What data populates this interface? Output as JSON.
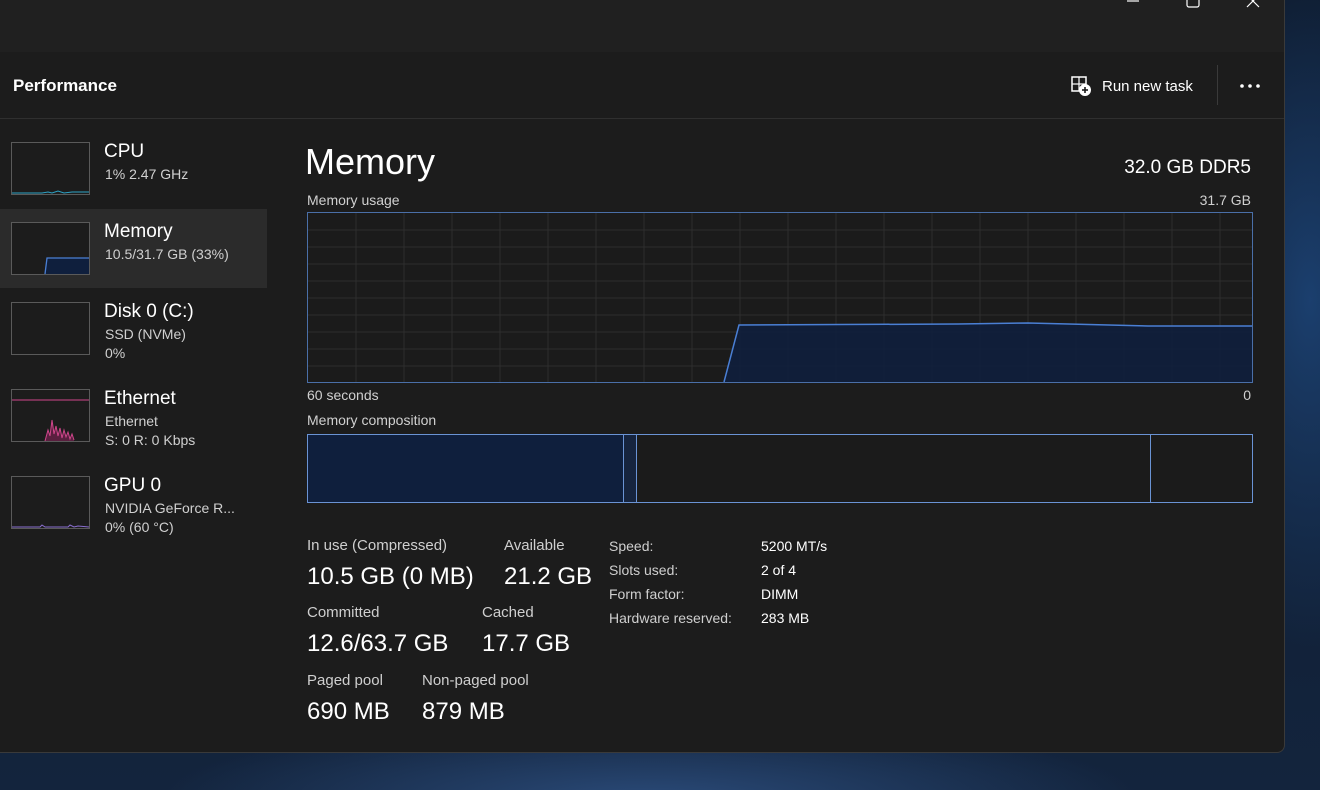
{
  "header": {
    "title": "Performance",
    "run_new_task": "Run new task"
  },
  "sidebar": {
    "items": [
      {
        "name": "CPU",
        "line1": "1% 2.47 GHz",
        "line2": ""
      },
      {
        "name": "Memory",
        "line1": "10.5/31.7 GB (33%)",
        "line2": ""
      },
      {
        "name": "Disk 0 (C:)",
        "line1": "SSD (NVMe)",
        "line2": "0%"
      },
      {
        "name": "Ethernet",
        "line1": "Ethernet",
        "line2": "S: 0 R: 0 Kbps"
      },
      {
        "name": "GPU 0",
        "line1": "NVIDIA GeForce R...",
        "line2": "0% (60 °C)"
      }
    ]
  },
  "main": {
    "title": "Memory",
    "spec": "32.0 GB DDR5",
    "usage_label": "Memory usage",
    "usage_max": "31.7 GB",
    "time_left": "60 seconds",
    "time_right": "0",
    "composition_label": "Memory composition",
    "stats": {
      "in_use_label": "In use (Compressed)",
      "in_use_value": "10.5 GB (0 MB)",
      "available_label": "Available",
      "available_value": "21.2 GB",
      "committed_label": "Committed",
      "committed_value": "12.6/63.7 GB",
      "cached_label": "Cached",
      "cached_value": "17.7 GB",
      "paged_label": "Paged pool",
      "paged_value": "690 MB",
      "nonpaged_label": "Non-paged pool",
      "nonpaged_value": "879 MB"
    },
    "specs": [
      {
        "key": "Speed:",
        "value": "5200 MT/s"
      },
      {
        "key": "Slots used:",
        "value": "2 of 4"
      },
      {
        "key": "Form factor:",
        "value": "DIMM"
      },
      {
        "key": "Hardware reserved:",
        "value": "283 MB"
      }
    ]
  },
  "colors": {
    "memory_accent": "#4a7fd4",
    "memory_fill": "#0f1f3d",
    "cpu_accent": "#2ea3c6",
    "ethernet_accent": "#d0468c",
    "gpu_accent": "#8a6fd0"
  }
}
